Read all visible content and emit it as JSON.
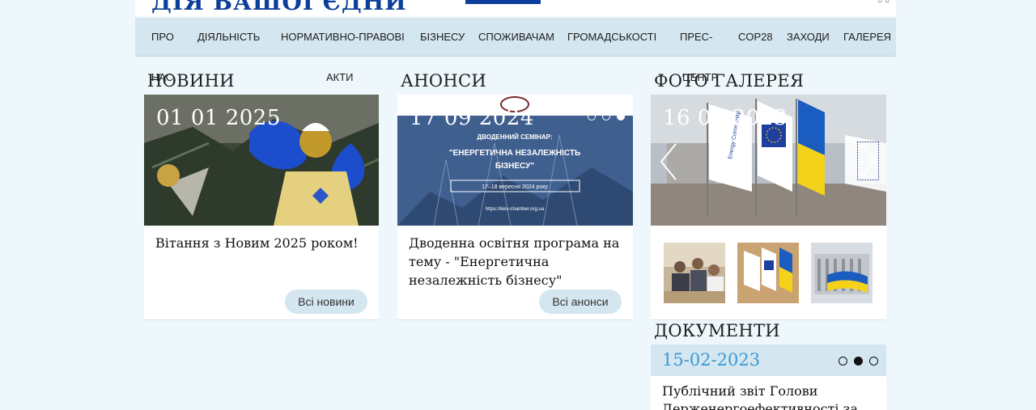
{
  "header": {
    "title_strip": "ДІЯ ВАШОЇ ЄДНИ",
    "corner_dots": "○ ○"
  },
  "nav": {
    "items": [
      "ПРО",
      "ДІЯЛЬНІСТЬ",
      "НОРМАТИВНО-ПРАВОВІ",
      "БІЗНЕСУ",
      "СПОЖИВАЧАМ",
      "ГРОМАДСЬКОСТІ",
      "ПРЕС-",
      "COP28",
      "ЗАХОДИ",
      "ГАЛЕРЕЯ"
    ],
    "sub_items": [
      "НАС",
      "АКТИ",
      "ЦЕНТР"
    ]
  },
  "news": {
    "title": "НОВИНИ",
    "date": "01 01 2025",
    "text": "Вітання з Новим 2025 роком!",
    "button": "Всі новини"
  },
  "announcements": {
    "title": "АНОНСИ",
    "date": "17 09 2024",
    "image_caption_1": "ДВОДЕННИЙ СЕМІНАР:",
    "image_caption_2": "\"ЕНЕРГЕТИЧНА НЕЗАЛЕЖНІСТЬ",
    "image_caption_3": "БІЗНЕСУ\"",
    "image_caption_4": "17–18 вересня 2024 року",
    "image_caption_5": "https://kiev-chamber.org.ua",
    "text": "Дводенна освітня програма на тему - \"Енергетична незалежність бізнесу\"",
    "button": "Всі анонси"
  },
  "gallery": {
    "title": "ФОТО ГАЛЕРЕЯ",
    "date": "16 03 2023",
    "flag_text": "Energy Community",
    "prev_icon": "chevron-left-icon",
    "next_icon": "chevron-right-icon"
  },
  "documents": {
    "title": "ДОКУМЕНТИ",
    "date": "15-02-2023",
    "text": "Публічний звіт Голови Держенергоефективності за"
  },
  "colors": {
    "nav_bg": "#d4e6ef",
    "page_bg": "#eef7fb",
    "accent_blue": "#3a9ad6",
    "brand_blue": "#0b3f9b"
  }
}
